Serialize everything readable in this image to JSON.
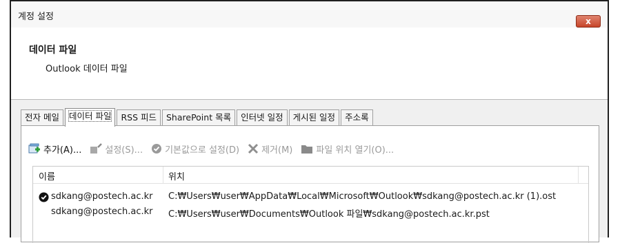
{
  "window": {
    "title": "계정 설정",
    "close_label": "x"
  },
  "header": {
    "title": "데이터 파일",
    "subtitle": "Outlook 데이터 파일"
  },
  "tabs": [
    {
      "label": "전자 메일",
      "active": false
    },
    {
      "label": "데이터 파일",
      "active": true
    },
    {
      "label": "RSS 피드",
      "active": false
    },
    {
      "label": "SharePoint 목록",
      "active": false
    },
    {
      "label": "인터넷 일정",
      "active": false
    },
    {
      "label": "게시된 일정",
      "active": false
    },
    {
      "label": "주소록",
      "active": false
    }
  ],
  "toolbar": {
    "add": "추가(A)...",
    "settings": "설정(S)...",
    "set_default": "기본값으로 설정(D)",
    "remove": "제거(M)",
    "open_location": "파일 위치 열기(O)..."
  },
  "list": {
    "columns": [
      "이름",
      "위치"
    ],
    "rows": [
      {
        "name": "sdkang@postech.ac.kr",
        "location": "C:₩Users₩user₩AppData₩Local₩Microsoft₩Outlook₩sdkang@postech.ac.kr (1).ost",
        "default": true
      },
      {
        "name": "sdkang@postech.ac.kr",
        "location": "C:₩Users₩user₩Documents₩Outlook 파일₩sdkang@postech.ac.kr.pst",
        "default": false
      }
    ]
  },
  "colors": {
    "close_button": "#c7452a",
    "add_icon_green": "#2f9e3a",
    "disabled_text": "#9a9a9a"
  },
  "icons": {
    "add": "add-data-file-icon",
    "settings": "settings-icon",
    "default": "checkmark-circle-icon",
    "remove": "x-remove-icon",
    "folder": "folder-icon"
  }
}
